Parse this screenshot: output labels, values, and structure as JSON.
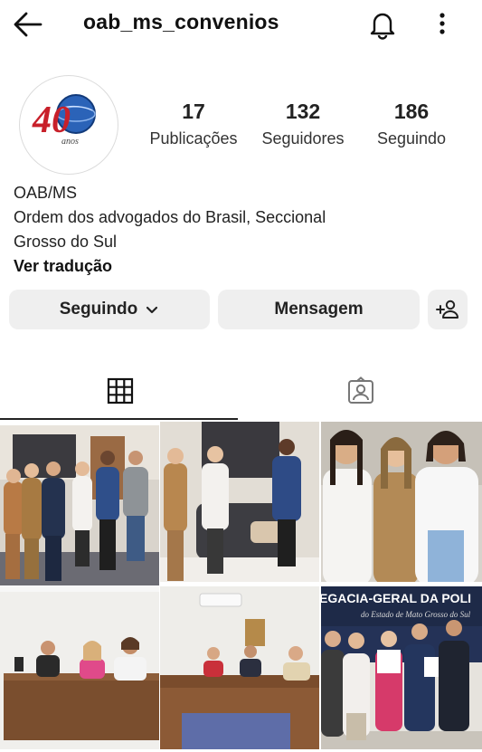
{
  "header": {
    "username": "oab_ms_convenios",
    "back_icon": "arrow-left-icon",
    "notifications_icon": "bell-icon",
    "more_icon": "more-vertical-icon"
  },
  "profile": {
    "avatar_text": "40",
    "avatar_subtext": "anos",
    "stats": [
      {
        "value": "17",
        "label": "Publicações"
      },
      {
        "value": "132",
        "label": "Seguidores"
      },
      {
        "value": "186",
        "label": "Seguindo"
      }
    ],
    "bio_name": "OAB/MS",
    "bio_line1": "Ordem dos advogados do Brasil,  Seccional",
    "bio_line2": "Grosso do Sul",
    "translate_label": "Ver tradução"
  },
  "actions": {
    "following_label": "Seguindo",
    "message_label": "Mensagem",
    "add_user_icon": "add-user-icon"
  },
  "tabs": {
    "grid_icon": "grid-icon",
    "tagged_icon": "tagged-person-icon"
  },
  "posts": {
    "banner_text_1": "EGACIA-GERAL DA POLI",
    "banner_text_2": "do Estado de Mato Grosso do Sul"
  },
  "colors": {
    "text": "#262626",
    "button_bg": "#efefef",
    "divider": "#dbdbdb",
    "oab_red": "#c8202a",
    "oab_blue": "#1f4e9e"
  }
}
